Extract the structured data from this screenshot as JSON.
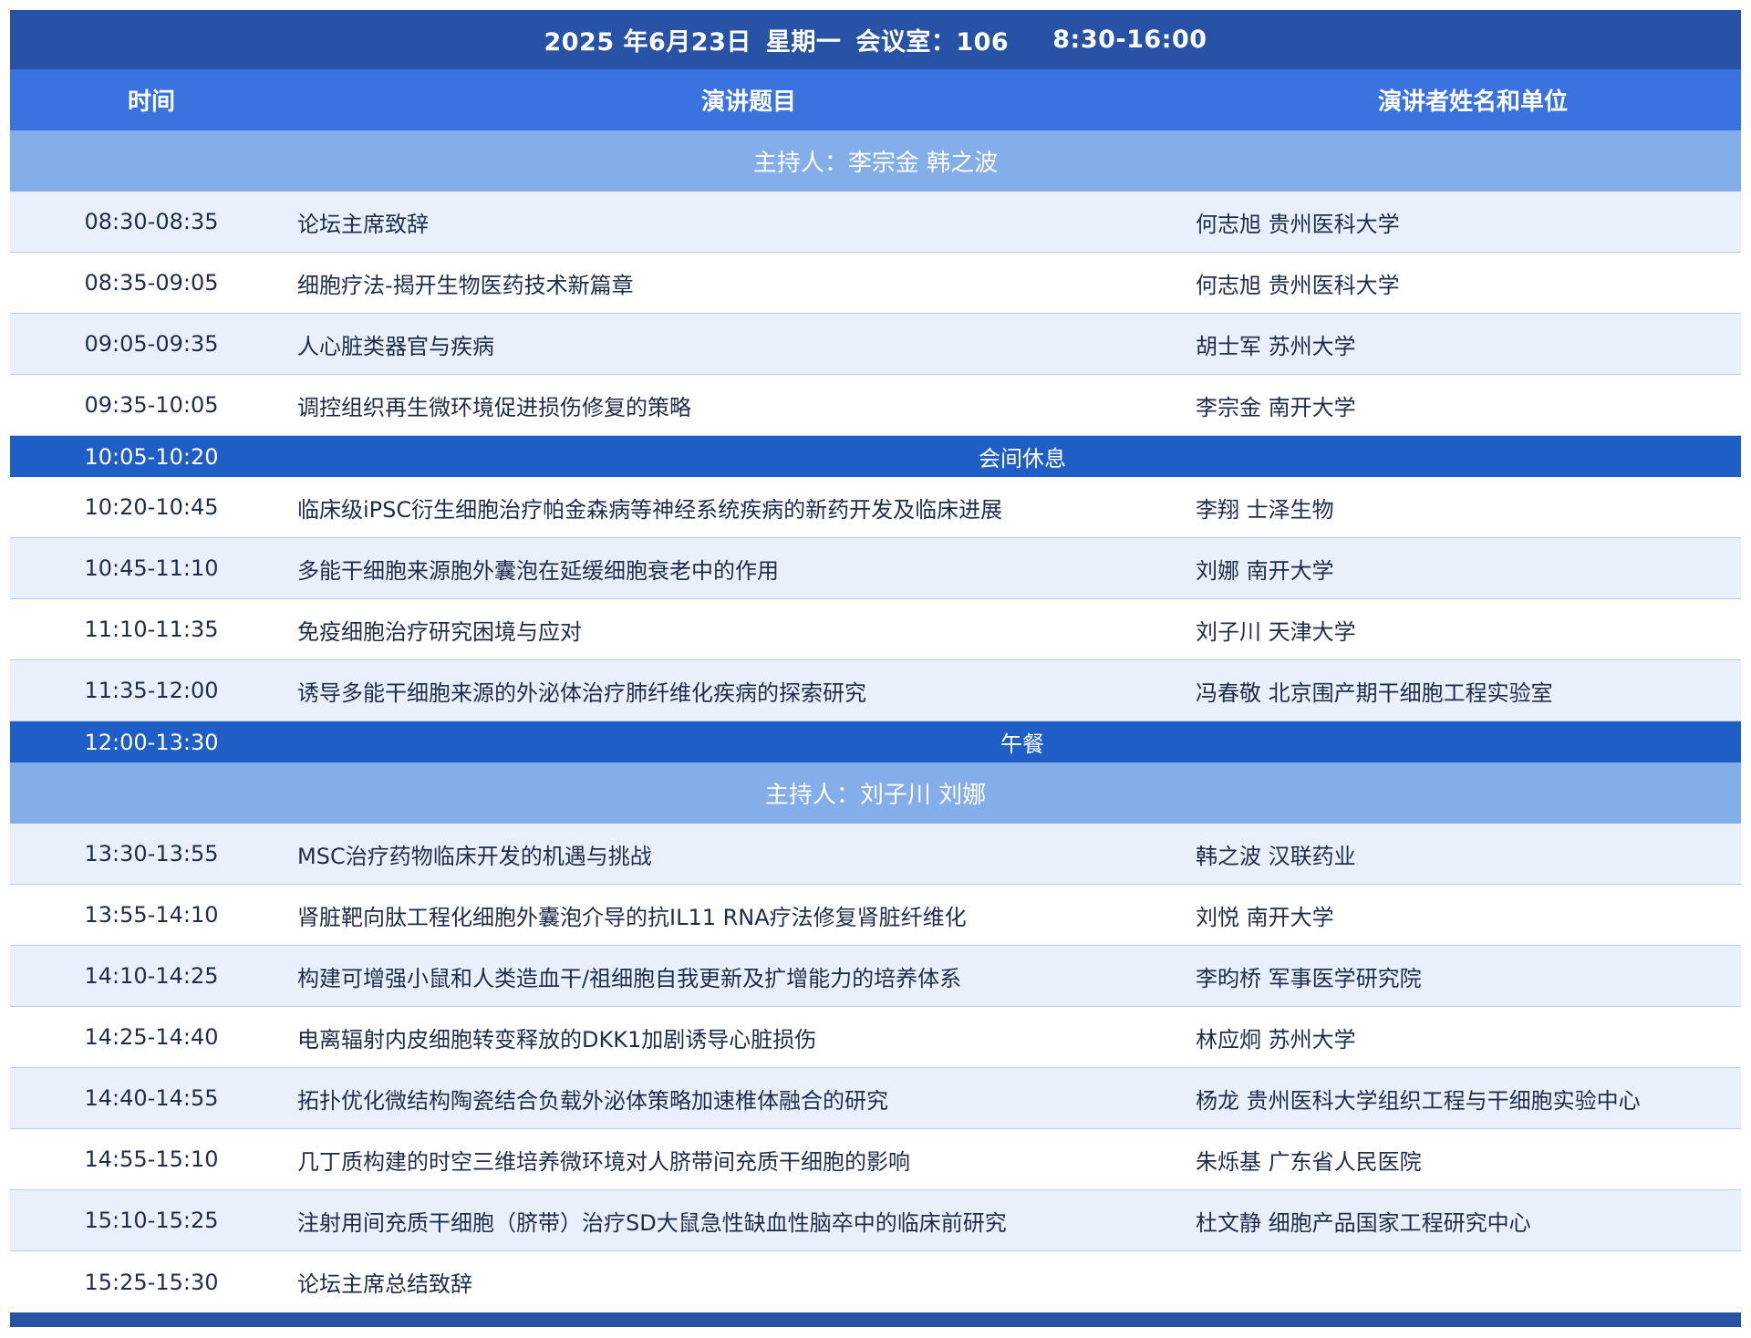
{
  "header": {
    "date": "2025 年6月23日",
    "weekday": "星期一",
    "room": "会议室：106",
    "time_range": "8:30-16:00"
  },
  "columns": {
    "time": "时间",
    "title": "演讲题目",
    "speaker": "演讲者姓名和单位"
  },
  "hosts": [
    "主持人：李宗金 韩之波",
    "主持人：刘子川 刘娜"
  ],
  "session1": [
    {
      "time": "08:30-08:35",
      "title": "论坛主席致辞",
      "speaker": "何志旭 贵州医科大学"
    },
    {
      "time": "08:35-09:05",
      "title": "细胞疗法-揭开生物医药技术新篇章",
      "speaker": "何志旭 贵州医科大学"
    },
    {
      "time": "09:05-09:35",
      "title": "人心脏类器官与疾病",
      "speaker": "胡士军 苏州大学"
    },
    {
      "time": "09:35-10:05",
      "title": "调控组织再生微环境促进损伤修复的策略",
      "speaker": "李宗金 南开大学"
    }
  ],
  "break1": {
    "time": "10:05-10:20",
    "label": "会间休息"
  },
  "session2": [
    {
      "time": "10:20-10:45",
      "title": "临床级iPSC衍生细胞治疗帕金森病等神经系统疾病的新药开发及临床进展",
      "speaker": "李翔 士泽生物"
    },
    {
      "time": "10:45-11:10",
      "title": "多能干细胞来源胞外囊泡在延缓细胞衰老中的作用",
      "speaker": "刘娜 南开大学"
    },
    {
      "time": "11:10-11:35",
      "title": "免疫细胞治疗研究困境与应对",
      "speaker": "刘子川 天津大学"
    },
    {
      "time": "11:35-12:00",
      "title": "诱导多能干细胞来源的外泌体治疗肺纤维化疾病的探索研究",
      "speaker": "冯春敬 北京围产期干细胞工程实验室"
    }
  ],
  "break2": {
    "time": "12:00-13:30",
    "label": "午餐"
  },
  "session3": [
    {
      "time": "13:30-13:55",
      "title": "MSC治疗药物临床开发的机遇与挑战",
      "speaker": "韩之波 汉联药业"
    },
    {
      "time": "13:55-14:10",
      "title": "肾脏靶向肽工程化细胞外囊泡介导的抗IL11 RNA疗法修复肾脏纤维化",
      "speaker": "刘悦 南开大学"
    },
    {
      "time": "14:10-14:25",
      "title": "构建可增强小鼠和人类造血干/祖细胞自我更新及扩增能力的培养体系",
      "speaker": "李昀桥 军事医学研究院"
    },
    {
      "time": "14:25-14:40",
      "title": "电离辐射内皮细胞转变释放的DKK1加剧诱导心脏损伤",
      "speaker": "林应炯 苏州大学"
    },
    {
      "time": "14:40-14:55",
      "title": "拓扑优化微结构陶瓷结合负载外泌体策略加速椎体融合的研究",
      "speaker": "杨龙 贵州医科大学组织工程与干细胞实验中心"
    },
    {
      "time": "14:55-15:10",
      "title": "几丁质构建的时空三维培养微环境对人脐带间充质干细胞的影响",
      "speaker": "朱烁基 广东省人民医院"
    },
    {
      "time": "15:10-15:25",
      "title": "注射用间充质干细胞（脐带）治疗SD大鼠急性缺血性脑卒中的临床前研究",
      "speaker": "杜文静 细胞产品国家工程研究中心"
    },
    {
      "time": "15:25-15:30",
      "title": "论坛主席总结致辞",
      "speaker": ""
    }
  ]
}
